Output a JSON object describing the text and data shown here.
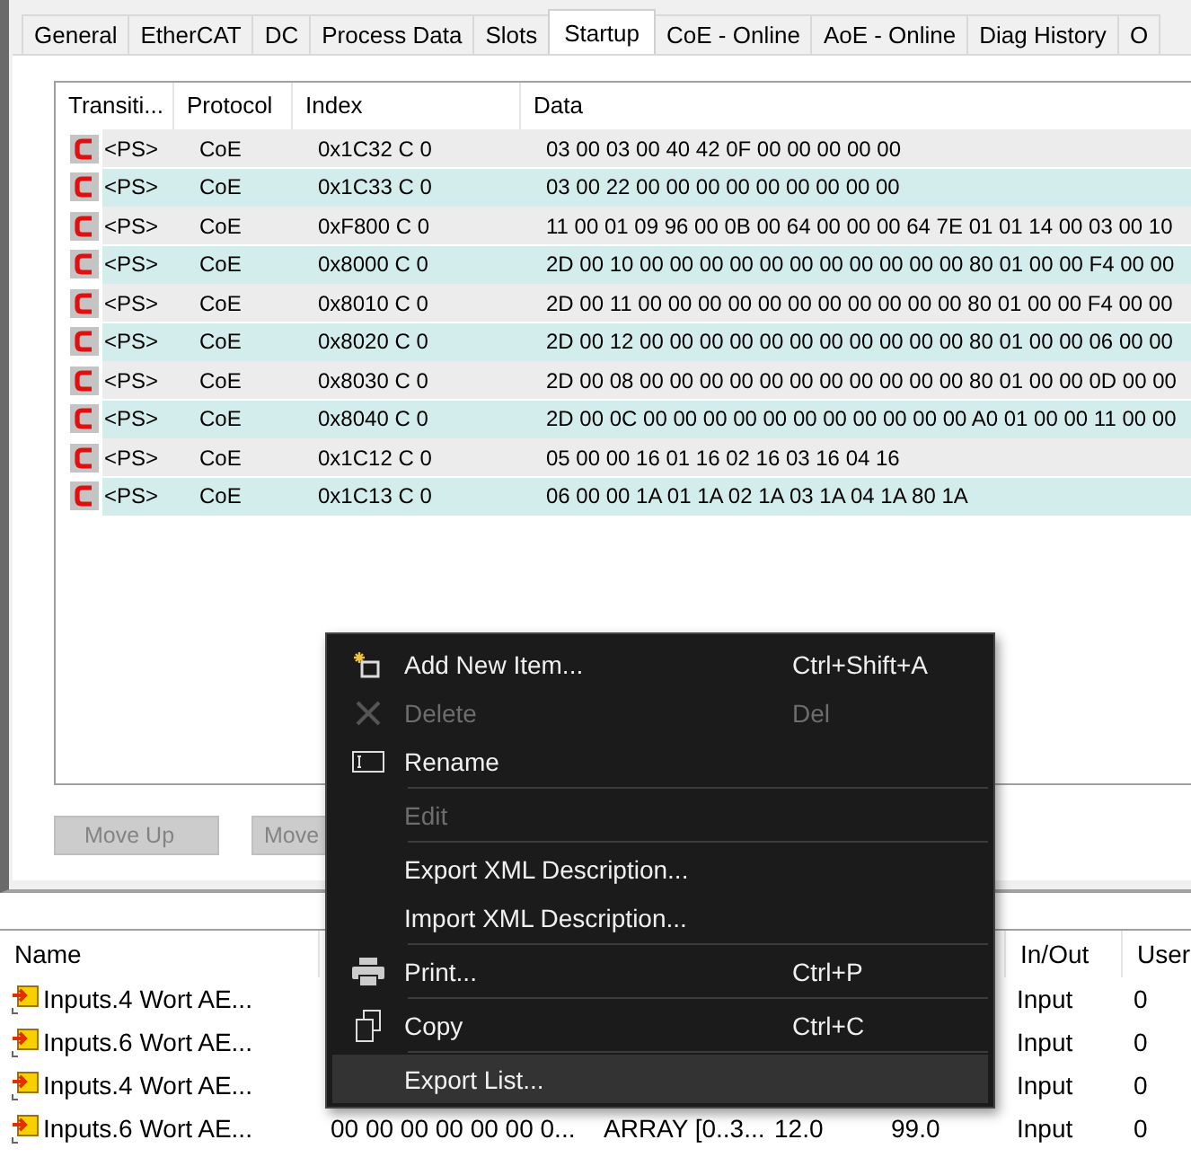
{
  "tabs": [
    {
      "label": "General",
      "selected": false
    },
    {
      "label": "EtherCAT",
      "selected": false
    },
    {
      "label": "DC",
      "selected": false
    },
    {
      "label": "Process Data",
      "selected": false
    },
    {
      "label": "Slots",
      "selected": false
    },
    {
      "label": "Startup",
      "selected": true
    },
    {
      "label": "CoE - Online",
      "selected": false
    },
    {
      "label": "AoE - Online",
      "selected": false
    },
    {
      "label": "Diag History",
      "selected": false
    },
    {
      "label": "O",
      "selected": false
    }
  ],
  "startup_table": {
    "columns": [
      "Transiti...",
      "Protocol",
      "Index",
      "Data"
    ],
    "rows": [
      {
        "transition": "<PS>",
        "protocol": "CoE",
        "index": "0x1C32 C 0",
        "data": "03 00 03 00 40 42 0F 00 00 00 00 00"
      },
      {
        "transition": "<PS>",
        "protocol": "CoE",
        "index": "0x1C33 C 0",
        "data": "03 00 22 00 00 00 00 00 00 00 00 00"
      },
      {
        "transition": "<PS>",
        "protocol": "CoE",
        "index": "0xF800 C 0",
        "data": "11 00 01 09 96 00 0B 00 64 00 00 00 64 7E 01 01 14 00 03 00 10"
      },
      {
        "transition": "<PS>",
        "protocol": "CoE",
        "index": "0x8000 C 0",
        "data": "2D 00 10 00 00 00 00 00 00 00 00 00 00 00 80 01 00 00 F4 00 00"
      },
      {
        "transition": "<PS>",
        "protocol": "CoE",
        "index": "0x8010 C 0",
        "data": "2D 00 11 00 00 00 00 00 00 00 00 00 00 00 80 01 00 00 F4 00 00"
      },
      {
        "transition": "<PS>",
        "protocol": "CoE",
        "index": "0x8020 C 0",
        "data": "2D 00 12 00 00 00 00 00 00 00 00 00 00 00 80 01 00 00 06 00 00"
      },
      {
        "transition": "<PS>",
        "protocol": "CoE",
        "index": "0x8030 C 0",
        "data": "2D 00 08 00 00 00 00 00 00 00 00 00 00 00 80 01 00 00 0D 00 00"
      },
      {
        "transition": "<PS>",
        "protocol": "CoE",
        "index": "0x8040 C 0",
        "data": "2D 00 0C 00 00 00 00 00 00 00 00 00 00 00 A0 01 00 00 11 00 00"
      },
      {
        "transition": "<PS>",
        "protocol": "CoE",
        "index": "0x1C12 C 0",
        "data": "05 00 00 16 01 16 02 16 03 16 04 16"
      },
      {
        "transition": "<PS>",
        "protocol": "CoE",
        "index": "0x1C13 C 0",
        "data": "06 00 00 1A 01 1A 02 1A 03 1A 04 1A 80 1A"
      }
    ]
  },
  "buttons": [
    {
      "label": "Move Up",
      "disabled": true
    },
    {
      "label": "Move",
      "disabled": true
    }
  ],
  "variables_table": {
    "columns": [
      "Name",
      "",
      "",
      "",
      "",
      "In/Out",
      "User"
    ],
    "rows": [
      {
        "cells": [
          "Inputs.4 Wort AE...",
          "",
          "",
          "",
          "",
          "Input",
          "0"
        ]
      },
      {
        "cells": [
          "Inputs.6 Wort AE...",
          "",
          "",
          "",
          "",
          "Input",
          "0"
        ]
      },
      {
        "cells": [
          "Inputs.4 Wort AE...",
          "",
          "",
          "",
          "",
          "Input",
          "0"
        ]
      },
      {
        "cells": [
          "Inputs.6 Wort AE...",
          "00 00 00 00 00 00 0...",
          "ARRAY [0..3...",
          "12.0",
          "99.0",
          "Input",
          "0"
        ]
      }
    ]
  },
  "context_menu": [
    {
      "kind": "item",
      "label": "Add New Item...",
      "shortcut": "Ctrl+Shift+A",
      "disabled": false,
      "selected": false
    },
    {
      "kind": "item",
      "label": "Delete",
      "shortcut": "Del",
      "disabled": true,
      "selected": false
    },
    {
      "kind": "item",
      "label": "Rename",
      "disabled": false,
      "selected": false
    },
    {
      "kind": "separator"
    },
    {
      "kind": "item",
      "label": "Edit",
      "disabled": true,
      "selected": false
    },
    {
      "kind": "separator"
    },
    {
      "kind": "item",
      "label": "Export XML Description...",
      "disabled": false,
      "selected": false
    },
    {
      "kind": "item",
      "label": "Import XML Description...",
      "disabled": false,
      "selected": false
    },
    {
      "kind": "separator"
    },
    {
      "kind": "item",
      "label": "Print...",
      "shortcut": "Ctrl+P",
      "disabled": false,
      "selected": false
    },
    {
      "kind": "separator"
    },
    {
      "kind": "item",
      "label": "Copy",
      "shortcut": "Ctrl+C",
      "disabled": false,
      "selected": false
    },
    {
      "kind": "separator"
    },
    {
      "kind": "item",
      "label": "Export List...",
      "disabled": false,
      "selected": true
    }
  ]
}
